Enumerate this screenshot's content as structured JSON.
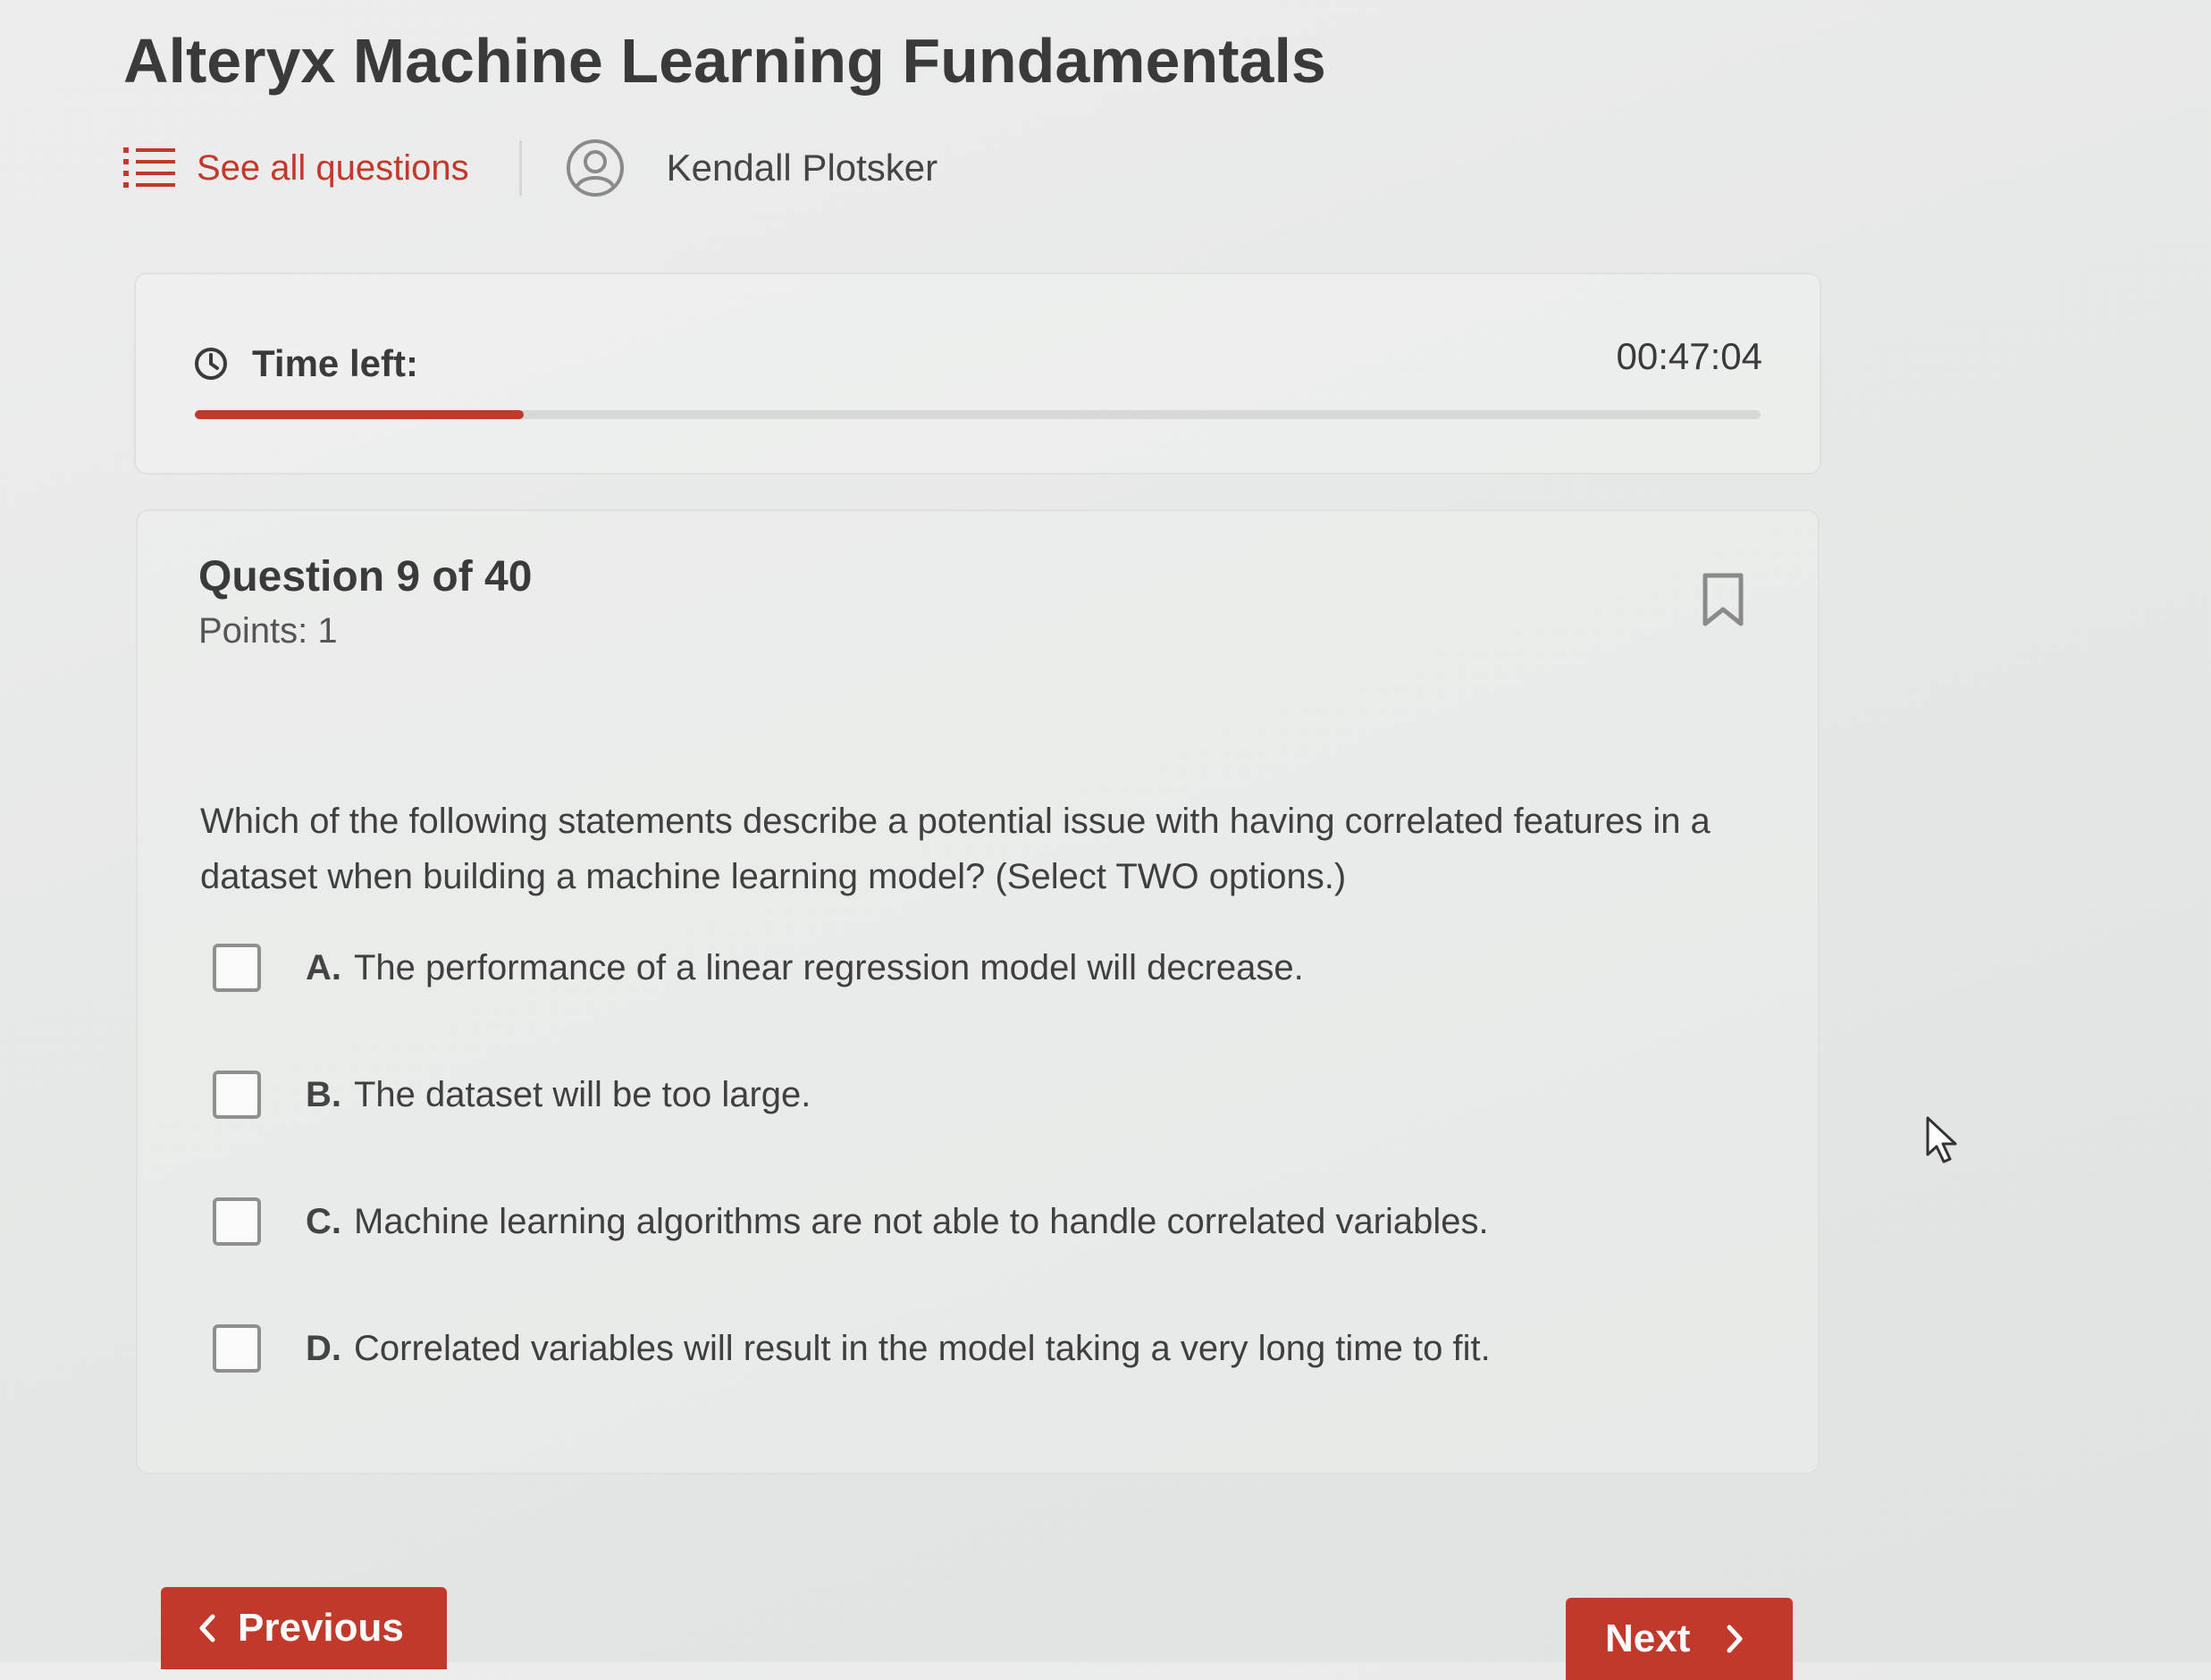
{
  "app": {
    "title": "Alteryx Machine Learning Fundamentals"
  },
  "toolbar": {
    "see_all_label": "See all questions",
    "see_all_icon": "list-icon",
    "user_icon": "user-avatar-icon",
    "user_name": "Kendall Plotsker"
  },
  "timer": {
    "icon": "clock-icon",
    "label": "Time left:",
    "value": "00:47:04",
    "progress_fraction": 0.21
  },
  "question": {
    "number_label": "Question 9 of 40",
    "points_label": "Points: 1",
    "bookmark_icon": "bookmark-icon",
    "text": "Which of the following statements describe a potential issue with having correlated features in a dataset when building a machine learning model? (Select TWO options.)",
    "options": [
      {
        "letter": "A.",
        "text": "The performance of a linear regression model will decrease.",
        "checked": false
      },
      {
        "letter": "B.",
        "text": "The dataset will be too large.",
        "checked": false
      },
      {
        "letter": "C.",
        "text": "Machine learning algorithms are not able to handle correlated variables.",
        "checked": false
      },
      {
        "letter": "D.",
        "text": "Correlated variables will result in the model taking a very long time to fit.",
        "checked": false
      }
    ]
  },
  "navigation": {
    "previous_label": "Previous",
    "next_label": "Next"
  },
  "colors": {
    "accent": "#c0392b",
    "text": "#3a3a3a",
    "border": "#e0e0e0",
    "track": "#d7d8d7"
  }
}
